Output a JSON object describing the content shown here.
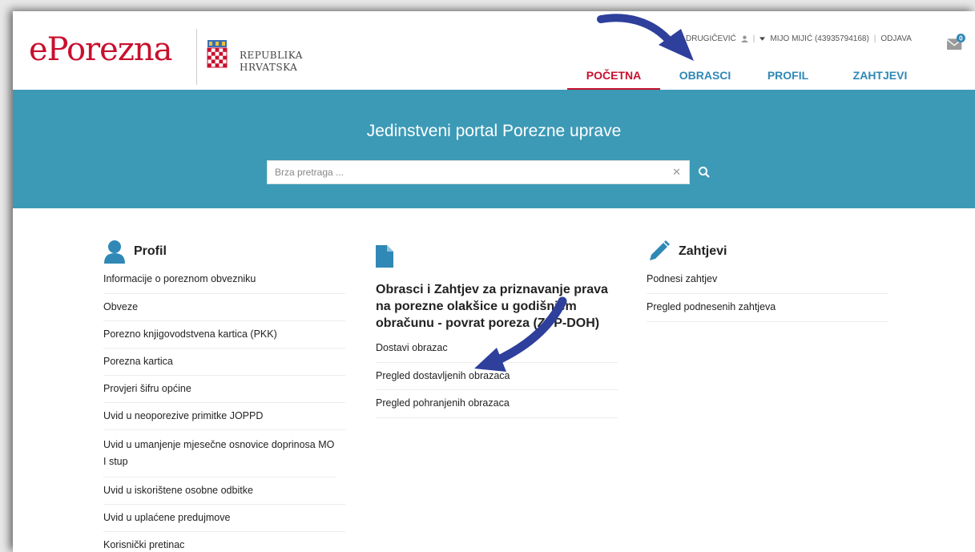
{
  "brand": {
    "logo": "ePorezna",
    "republic_line1": "REPUBLIKA",
    "republic_line2": "HRVATSKA"
  },
  "user_bar": {
    "user1": "DRUGIČEVIĆ",
    "user2": "MIJO MIJIĆ (43935794168)",
    "logout": "ODJAVA",
    "mail_count": "0"
  },
  "nav": [
    {
      "label": "POČETNA",
      "active": true
    },
    {
      "label": "OBRASCI",
      "active": false
    },
    {
      "label": "PROFIL",
      "active": false
    },
    {
      "label": "ZAHTJEVI",
      "active": false
    }
  ],
  "banner": {
    "title": "Jedinstveni portal Porezne uprave",
    "search_placeholder": "Brza pretraga ..."
  },
  "profil": {
    "title": "Profil",
    "items": [
      "Informacije o poreznom obvezniku",
      "Obveze",
      "Porezno knjigovodstvena kartica (PKK)",
      "Porezna kartica",
      "Provjeri šifru općine",
      "Uvid u neoporezive primitke JOPPD",
      "Uvid u umanjenje mjesečne osnovice doprinosa MO I stup",
      "Uvid u iskorištene osobne odbitke",
      "Uvid u uplaćene predujmove",
      "Korisnički pretinac"
    ]
  },
  "obrasci": {
    "title": "Obrasci i Zahtjev za priznavanje prava na porezne olakšice u godišnjem obračunu - povrat poreza (ZPP-DOH)",
    "items": [
      "Dostavi obrazac",
      "Pregled dostavljenih obrazaca",
      "Pregled pohranjenih obrazaca"
    ]
  },
  "zahtjevi": {
    "title": "Zahtjevi",
    "items": [
      "Podnesi zahtjev",
      "Pregled podnesenih zahtjeva"
    ]
  },
  "colors": {
    "accent_red": "#c8102e",
    "link_blue": "#2f88b5",
    "banner": "#3c9ab6",
    "annotation_arrow": "#2e3f9c"
  }
}
